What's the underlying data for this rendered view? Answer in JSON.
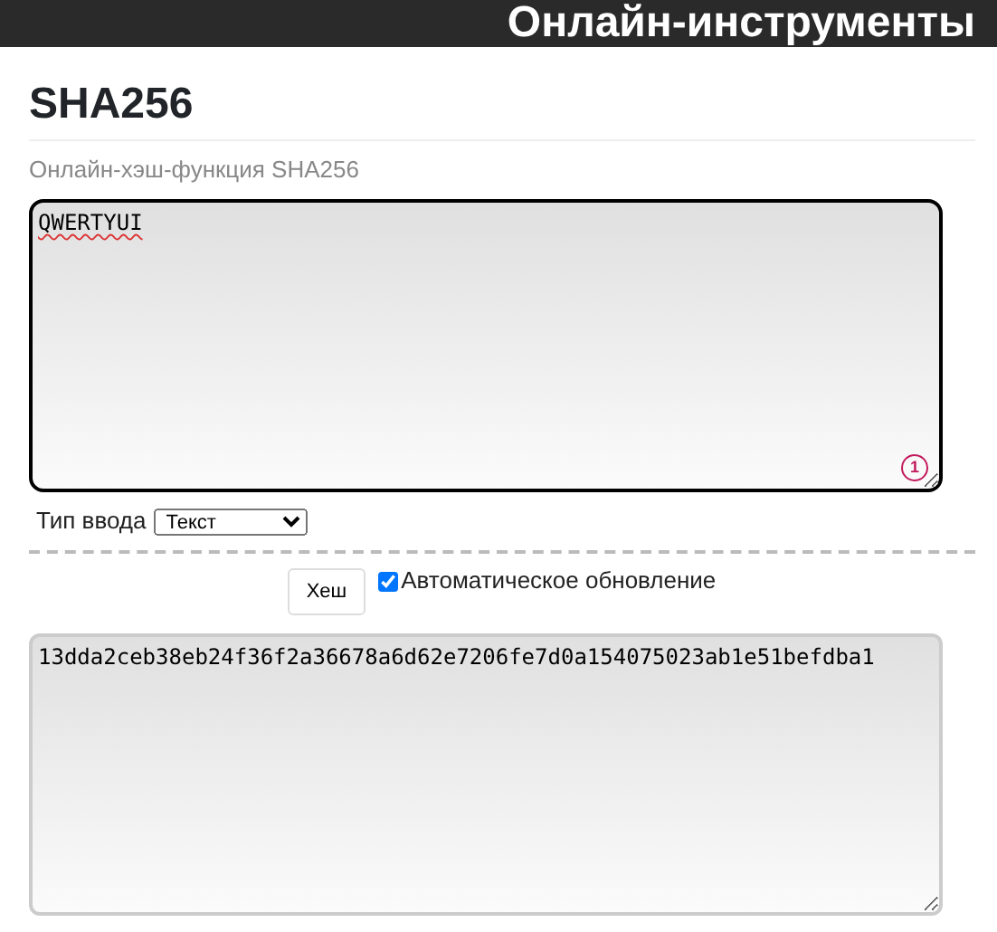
{
  "header": {
    "title": "Онлайн-инструменты"
  },
  "page": {
    "title": "SHA256",
    "subtitle": "Онлайн-хэш-функция SHA256"
  },
  "input": {
    "value": "QWERTYUI",
    "badge": "1"
  },
  "input_type": {
    "label": "Тип ввода",
    "value": "Текст"
  },
  "hash_button": "Хеш",
  "auto_update": {
    "label": "Автоматическое обновление",
    "checked": true
  },
  "output": {
    "value": "13dda2ceb38eb24f36f2a36678a6d62e7206fe7d0a154075023ab1e51befdba1"
  }
}
